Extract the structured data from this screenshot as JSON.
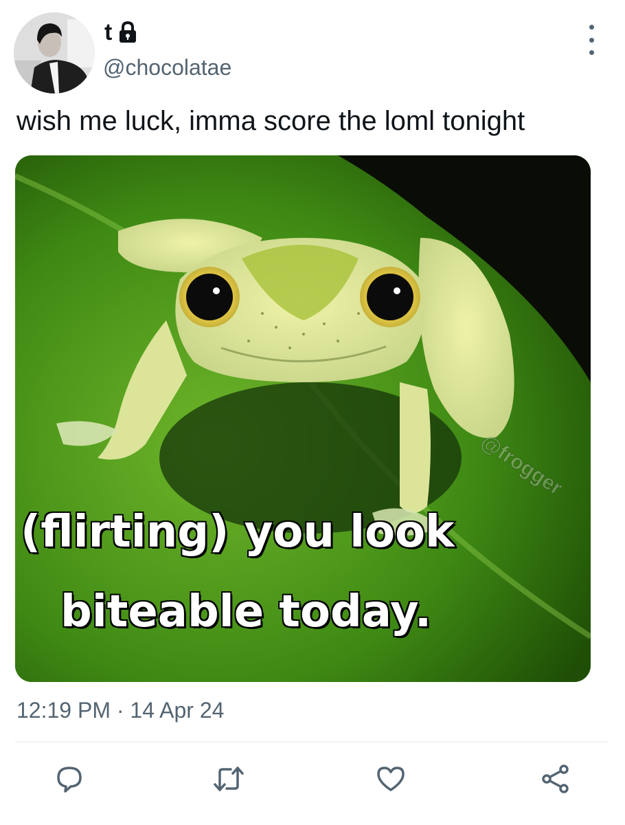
{
  "tweet": {
    "display_name": "t",
    "handle": "@chocolatae",
    "text": "wish me luck, imma score the loml tonight",
    "timestamp": "12:19 PM · 14 Apr 24",
    "media": {
      "caption_line_1": "(flirting) you look",
      "caption_line_2": "biteable today.",
      "watermark": "@frogger"
    }
  },
  "icons": {
    "lock": "lock-icon",
    "more": "more-vertical-icon",
    "reply": "reply-icon",
    "retweet": "retweet-icon",
    "like": "heart-icon",
    "share": "share-icon"
  },
  "colors": {
    "text_primary": "#0f1419",
    "text_secondary": "#536471",
    "icon": "#536471",
    "divider": "#eff3f4"
  }
}
